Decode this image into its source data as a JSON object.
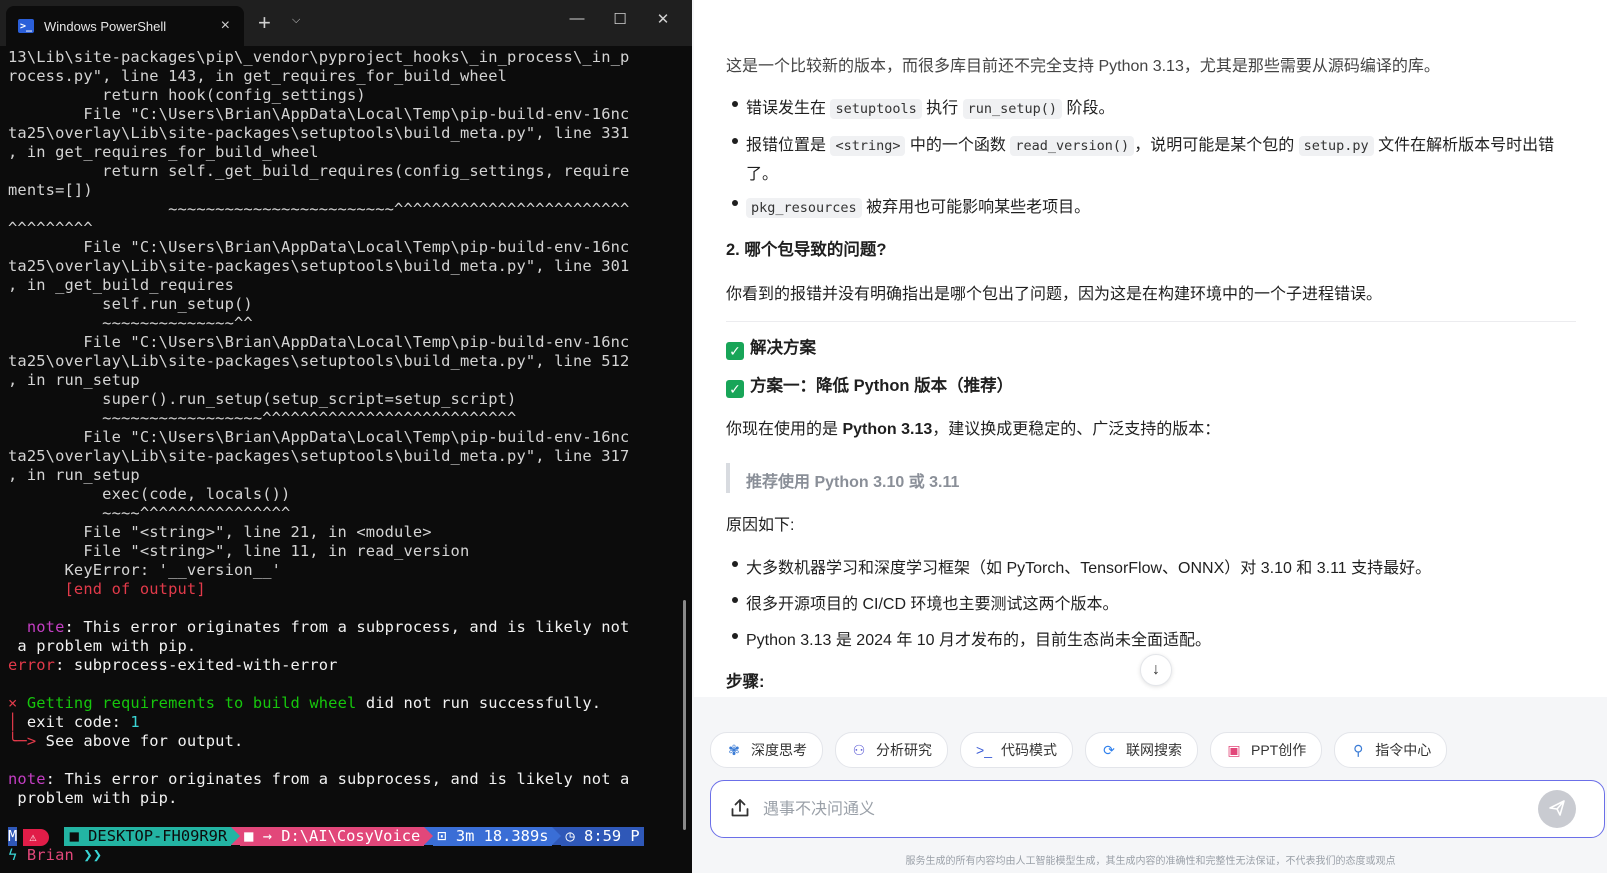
{
  "terminal": {
    "tab_title": "Windows PowerShell",
    "icons": {
      "app": "powershell-icon",
      "close": "×",
      "new_tab": "+",
      "dropdown": "⌵",
      "minimize": "—",
      "maximize": "☐",
      "window_close": "✕"
    },
    "lines": [
      "13\\Lib\\site-packages\\pip\\_vendor\\pyproject_hooks\\_in_process\\_in_p",
      "rocess.py\", line 143, in get_requires_for_build_wheel",
      "          return hook(config_settings)",
      "        File \"C:\\Users\\Brian\\AppData\\Local\\Temp\\pip-build-env-16nc",
      "ta25\\overlay\\Lib\\site-packages\\setuptools\\build_meta.py\", line 331",
      ", in get_requires_for_build_wheel",
      "          return self._get_build_requires(config_settings, require",
      "ments=[])",
      "                 ~~~~~~~~~~~~~~~~~~~~~~~~^^^^^^^^^^^^^^^^^^^^^^^^^",
      "^^^^^^^^^",
      "        File \"C:\\Users\\Brian\\AppData\\Local\\Temp\\pip-build-env-16nc",
      "ta25\\overlay\\Lib\\site-packages\\setuptools\\build_meta.py\", line 301",
      ", in _get_build_requires",
      "          self.run_setup()",
      "          ~~~~~~~~~~~~~~^^",
      "        File \"C:\\Users\\Brian\\AppData\\Local\\Temp\\pip-build-env-16nc",
      "ta25\\overlay\\Lib\\site-packages\\setuptools\\build_meta.py\", line 512",
      ", in run_setup",
      "          super().run_setup(setup_script=setup_script)",
      "          ~~~~~~~~~~~~~~~~~^^^^^^^^^^^^^^^^^^^^^^^^^^^",
      "        File \"C:\\Users\\Brian\\AppData\\Local\\Temp\\pip-build-env-16nc",
      "ta25\\overlay\\Lib\\site-packages\\setuptools\\build_meta.py\", line 317",
      ", in run_setup",
      "          exec(code, locals())",
      "          ~~~~^^^^^^^^^^^^^^^^",
      "        File \"<string>\", line 21, in <module>",
      "        File \"<string>\", line 11, in read_version",
      "      KeyError: '__version__'"
    ],
    "end_output": "      [end of output]",
    "blank": " ",
    "note1": {
      "indent": "  ",
      "label": "note",
      "text": ": This error originates from a subprocess, and is likely not",
      "text2": " a problem with pip."
    },
    "error_line": {
      "label": "error",
      "text": ": subprocess-exited-with-error"
    },
    "fail": {
      "x": "×",
      "msg": " Getting requirements to build wheel",
      "rest": " did not run successfully."
    },
    "exit_code": {
      "prefix": "│ ",
      "text": "exit code: ",
      "value": "1"
    },
    "see_above": {
      "prefix": "╰─> ",
      "text": "See above for output."
    },
    "note2": {
      "label": "note",
      "text": ": This error originates from a subprocess, and is likely not a",
      "text2": " problem with pip."
    },
    "prompt": {
      "host": "DESKTOP-FH09R9R",
      "path": "D:\\AI\\CosyVoice",
      "duration": "3m 18.389s",
      "time": "8:59 P",
      "time_wrap": "M",
      "user": "Brian",
      "chevrons": "❯❯"
    }
  },
  "chat": {
    "cut_line": "这是一个比较新的版本，而很多库目前还不完全支持 Python 3.13，尤其是那些需要从源码编译的库。",
    "bullets1": [
      {
        "a": "错误发生在 ",
        "code1": "setuptools",
        "b": " 执行 ",
        "code2": "run_setup()",
        "c": " 阶段。"
      },
      {
        "a": "报错位置是 ",
        "code1": "<string>",
        "b": " 中的一个函数 ",
        "code2": "read_version()",
        "c": "，说明可能是某个包的 ",
        "code3": "setup.py",
        "d": " 文件在解析版本号时出错",
        "e": "了。"
      },
      {
        "code1": "pkg_resources",
        "a": " 被弃用也可能影响某些老项目。"
      }
    ],
    "h2": "2. 哪个包导致的问题?",
    "p2": "你看到的报错并没有明确指出是哪个包出了问题，因为这是在构建环境中的一个子进程错误。",
    "solutions_title": "解决方案",
    "option1_title": "方案一：降低 Python 版本（推荐）",
    "p3_a": "你现在使用的是 ",
    "p3_b": "Python 3.13",
    "p3_c": "，建议换成更稳定的、广泛支持的版本：",
    "quote": "推荐使用 Python 3.10 或 3.11",
    "reason_title": "原因如下:",
    "reasons": [
      "大多数机器学习和深度学习框架（如 PyTorch、TensorFlow、ONNX）对 3.10 和 3.11 支持最好。",
      "很多开源项目的 CI/CD 环境也主要测试这两个版本。",
      "Python 3.13 是 2024 年 10 月才发布的，目前生态尚未全面适配。"
    ],
    "steps_title": "步骤:",
    "scroll_down": "↓",
    "chips": [
      {
        "icon": "deep-think-icon",
        "glyph": "✾",
        "color": "#3a7bd5",
        "label": "深度思考"
      },
      {
        "icon": "analysis-icon",
        "glyph": "⚇",
        "color": "#5b5bd6",
        "label": "分析研究"
      },
      {
        "icon": "code-icon",
        "glyph": ">_",
        "color": "#3a5bd6",
        "label": "代码模式"
      },
      {
        "icon": "web-search-icon",
        "glyph": "⟳",
        "color": "#2f80ed",
        "label": "联网搜索"
      },
      {
        "icon": "ppt-icon",
        "glyph": "▣",
        "color": "#e2477a",
        "label": "PPT创作"
      },
      {
        "icon": "command-center-icon",
        "glyph": "⚲",
        "color": "#3a7bd5",
        "label": "指令中心"
      }
    ],
    "input": {
      "placeholder": "遇事不决问通义",
      "value": ""
    },
    "disclaimer": "服务生成的所有内容均由人工智能模型生成，其生成内容的准确性和完整性无法保证，不代表我们的态度或观点"
  }
}
